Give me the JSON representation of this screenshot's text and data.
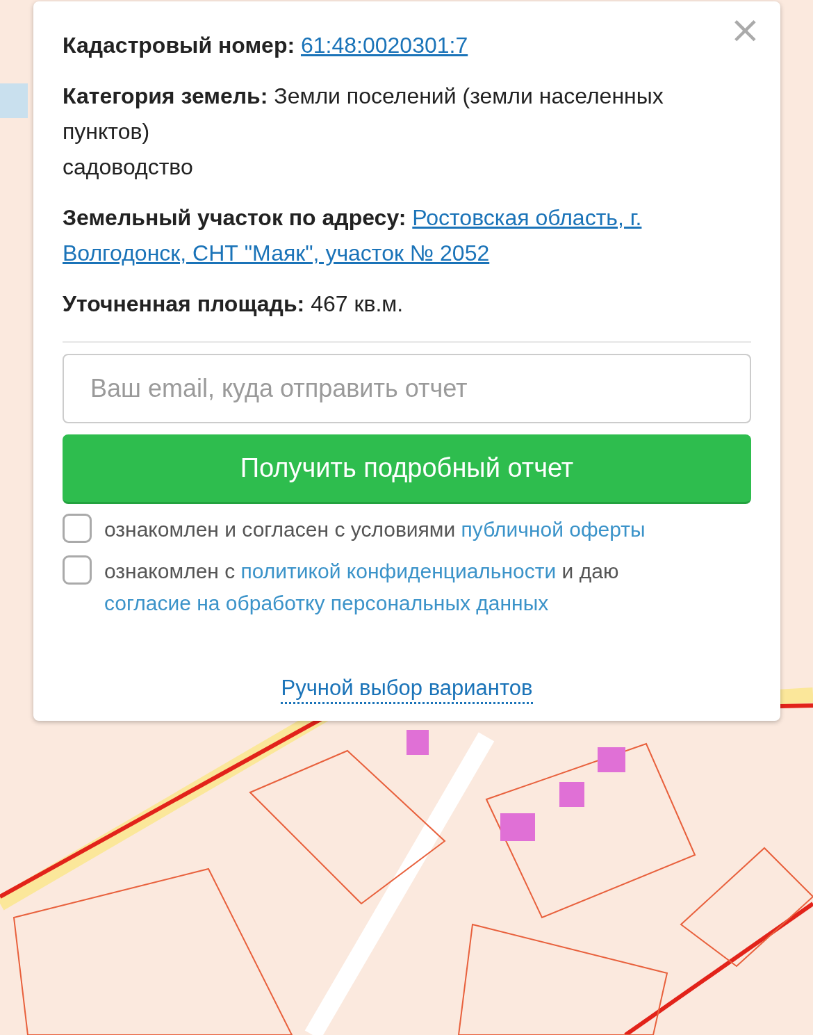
{
  "popup": {
    "close": "×",
    "fields": [
      {
        "label": "Кадастровый номер:",
        "lines": [
          "61:48:0020301:7"
        ],
        "kind": "link"
      },
      {
        "label": "Категория земель:",
        "lines": [
          "Земли поселений (земли населенных",
          "пунктов)"
        ],
        "kind": "text",
        "note": "садоводство"
      },
      {
        "label": "Земельный участок по адресу:",
        "lines": [
          "Ростовская область, г.",
          "Волгодонск, СНТ \"Маяк\", участок № 2052"
        ],
        "kind": "link"
      },
      {
        "label": "Уточненная площадь:",
        "lines": [
          "467 кв.м."
        ],
        "kind": "text"
      }
    ],
    "email": {
      "placeholder": "Ваш email, куда отправить отчет"
    },
    "submit": "Получить подробный отчет",
    "consents": [
      {
        "checked": false,
        "lines": [
          [
            {
              "text": "ознакомлен и согласен с условиями",
              "kind": "text"
            },
            {
              "text": "публичной оферты",
              "kind": "link"
            }
          ]
        ]
      },
      {
        "checked": false,
        "lines": [
          [
            {
              "text": "ознакомлен с",
              "kind": "text"
            },
            {
              "text": "политикой конфиденциальности",
              "kind": "link"
            },
            {
              "text": "и даю",
              "kind": "text"
            }
          ],
          [
            {
              "text": "согласие на обработку персональных данных",
              "kind": "link"
            }
          ]
        ]
      }
    ],
    "manual": "Ручной выбор вариантов"
  }
}
